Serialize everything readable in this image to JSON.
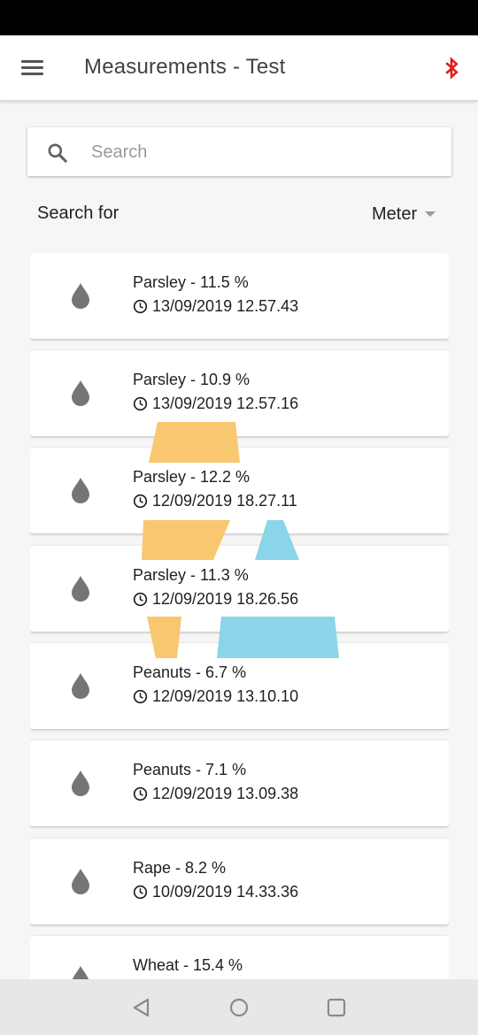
{
  "app_bar": {
    "title": "Measurements - Test",
    "bluetooth_color": "#e21b1b",
    "menu_icon": "hamburger-menu-icon",
    "bluetooth_icon": "bluetooth-icon"
  },
  "search": {
    "placeholder": "Search",
    "value": "",
    "icon": "search-icon"
  },
  "filter": {
    "label": "Search for",
    "selected": "Meter"
  },
  "measurements": [
    {
      "title": "Parsley - 11.5 %",
      "time": "13/09/2019 12.57.43"
    },
    {
      "title": "Parsley - 10.9 %",
      "time": "13/09/2019 12.57.16"
    },
    {
      "title": "Parsley - 12.2 %",
      "time": "12/09/2019 18.27.11"
    },
    {
      "title": "Parsley - 11.3 %",
      "time": "12/09/2019 18.26.56"
    },
    {
      "title": "Peanuts - 6.7 %",
      "time": "12/09/2019 13.10.10"
    },
    {
      "title": "Peanuts - 7.1 %",
      "time": "12/09/2019 13.09.38"
    },
    {
      "title": "Rape - 8.2 %",
      "time": "10/09/2019 14.33.36"
    },
    {
      "title": "Wheat - 15.4 %",
      "time": ""
    }
  ],
  "colors": {
    "accent_orange": "#f9c76f",
    "accent_blue": "#8ad6e8",
    "icon_grey": "#757575"
  },
  "nav_bar": {
    "icons": [
      "back-triangle-icon",
      "home-circle-icon",
      "recents-square-icon"
    ]
  }
}
